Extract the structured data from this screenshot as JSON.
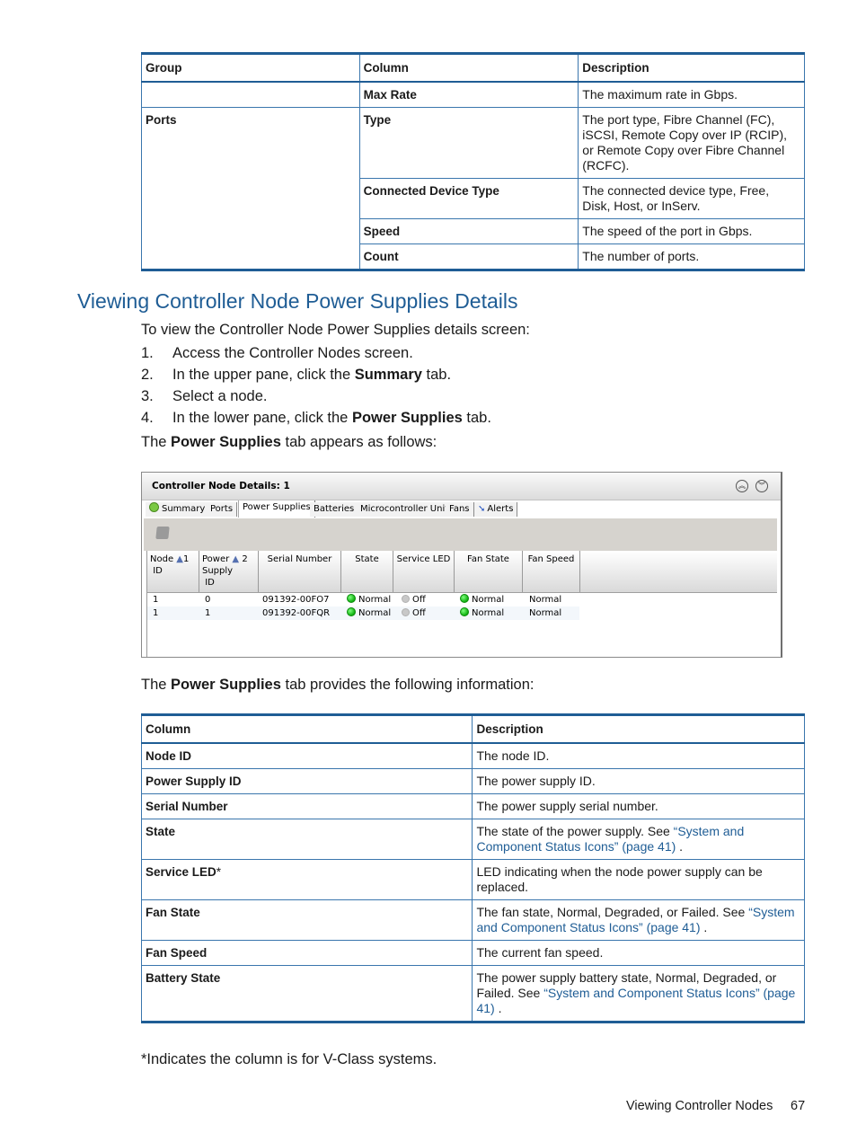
{
  "top_table": {
    "headers": [
      "Group",
      "Column",
      "Description"
    ],
    "rows": [
      {
        "group": "",
        "column": "Max Rate",
        "description": "The maximum rate in Gbps."
      },
      {
        "group": "Ports",
        "column": "Type",
        "description": "The port type, Fibre Channel (FC), iSCSI, Remote Copy over IP (RCIP), or Remote Copy over Fibre Channel (RCFC)."
      },
      {
        "group": "",
        "column": "Connected Device Type",
        "description": "The connected device type, Free, Disk, Host, or InServ."
      },
      {
        "group": "",
        "column": "Speed",
        "description": "The speed of the port in Gbps."
      },
      {
        "group": "",
        "column": "Count",
        "description": "The number of ports."
      }
    ]
  },
  "section": {
    "title": "Viewing Controller Node Power Supplies Details",
    "intro": "To view the Controller Node Power Supplies details screen:",
    "steps": [
      {
        "num": "1.",
        "pre": "Access the Controller Nodes screen.",
        "bold": "",
        "post": ""
      },
      {
        "num": "2.",
        "pre": "In the upper pane, click the ",
        "bold": "Summary",
        "post": " tab."
      },
      {
        "num": "3.",
        "pre": "Select a node.",
        "bold": "",
        "post": ""
      },
      {
        "num": "4.",
        "pre": "In the lower pane, click the ",
        "bold": "Power Supplies",
        "post": " tab."
      }
    ],
    "appears": {
      "pre": "The ",
      "bold": "Power Supplies",
      "post": " tab appears as follows:"
    },
    "provides": {
      "pre": "The ",
      "bold": "Power Supplies",
      "post": " tab provides the following information:"
    }
  },
  "screenshot": {
    "title": "Controller Node Details: 1",
    "collapse_icon": "double-chevron-up-icon",
    "expand_icon": "double-chevron-down-icon",
    "tabs": [
      {
        "label": "Summary",
        "icon": "status-ok-icon",
        "active": false
      },
      {
        "label": "Ports",
        "active": false
      },
      {
        "label": "Power Supplies",
        "active": true
      },
      {
        "label": "Batteries",
        "active": false
      },
      {
        "label": "Microcontroller Unit",
        "active": false
      },
      {
        "label": "Fans",
        "active": false
      },
      {
        "label": "Alerts",
        "icon": "alert-arrow-icon",
        "active": false
      }
    ],
    "toolbar_icon": "export-icon",
    "columns": [
      {
        "label": "Node ID",
        "line1": "Node",
        "line2": "ID",
        "sort": "1"
      },
      {
        "label": "Power Supply ID",
        "line1": "Power",
        "line2": "Supply",
        "line3": "ID",
        "sort": "2"
      },
      {
        "label": "Serial Number"
      },
      {
        "label": "State"
      },
      {
        "label": "Service LED"
      },
      {
        "label": "Fan State"
      },
      {
        "label": "Fan Speed"
      }
    ],
    "rows": [
      {
        "node_id": "1",
        "ps_id": "0",
        "serial": "091392-00FO7",
        "state": "Normal",
        "service_led": "Off",
        "fan_state": "Normal",
        "fan_speed": "Normal"
      },
      {
        "node_id": "1",
        "ps_id": "1",
        "serial": "091392-00FQR",
        "state": "Normal",
        "service_led": "Off",
        "fan_state": "Normal",
        "fan_speed": "Normal"
      }
    ],
    "status_colors": {
      "normal": "#10b010",
      "off": "#c8c8c8"
    }
  },
  "info_table": {
    "headers": [
      "Column",
      "Description"
    ],
    "rows": [
      {
        "column": "Node ID",
        "description": "The node ID.",
        "link": "",
        "after": ""
      },
      {
        "column": "Power Supply ID",
        "description": "The power supply ID.",
        "link": "",
        "after": ""
      },
      {
        "column": "Serial Number",
        "description": "The power supply serial number.",
        "link": "",
        "after": ""
      },
      {
        "column": "State",
        "description": "The state of the power supply. See ",
        "link": "“System and Component Status Icons” (page 41)",
        "after": " ."
      },
      {
        "column": "Service LED",
        "asterisk": "*",
        "description": "LED indicating when the node power supply can be replaced.",
        "link": "",
        "after": ""
      },
      {
        "column": "Fan State",
        "description": "The fan state, Normal, Degraded, or Failed. See ",
        "link": "“System and Component Status Icons” (page 41)",
        "after": " ."
      },
      {
        "column": "Fan Speed",
        "description": "The current fan speed.",
        "link": "",
        "after": ""
      },
      {
        "column": "Battery State",
        "description": "The power supply battery state, Normal, Degraded, or Failed. See ",
        "link": "“System and Component Status Icons” (page 41)",
        "after": " ."
      }
    ]
  },
  "footnote": "*Indicates the column is for V-Class systems.",
  "footer": {
    "label": "Viewing Controller Nodes",
    "page": "67"
  },
  "colors": {
    "accent": "#1f5d95",
    "rule": "#3a76ad"
  }
}
